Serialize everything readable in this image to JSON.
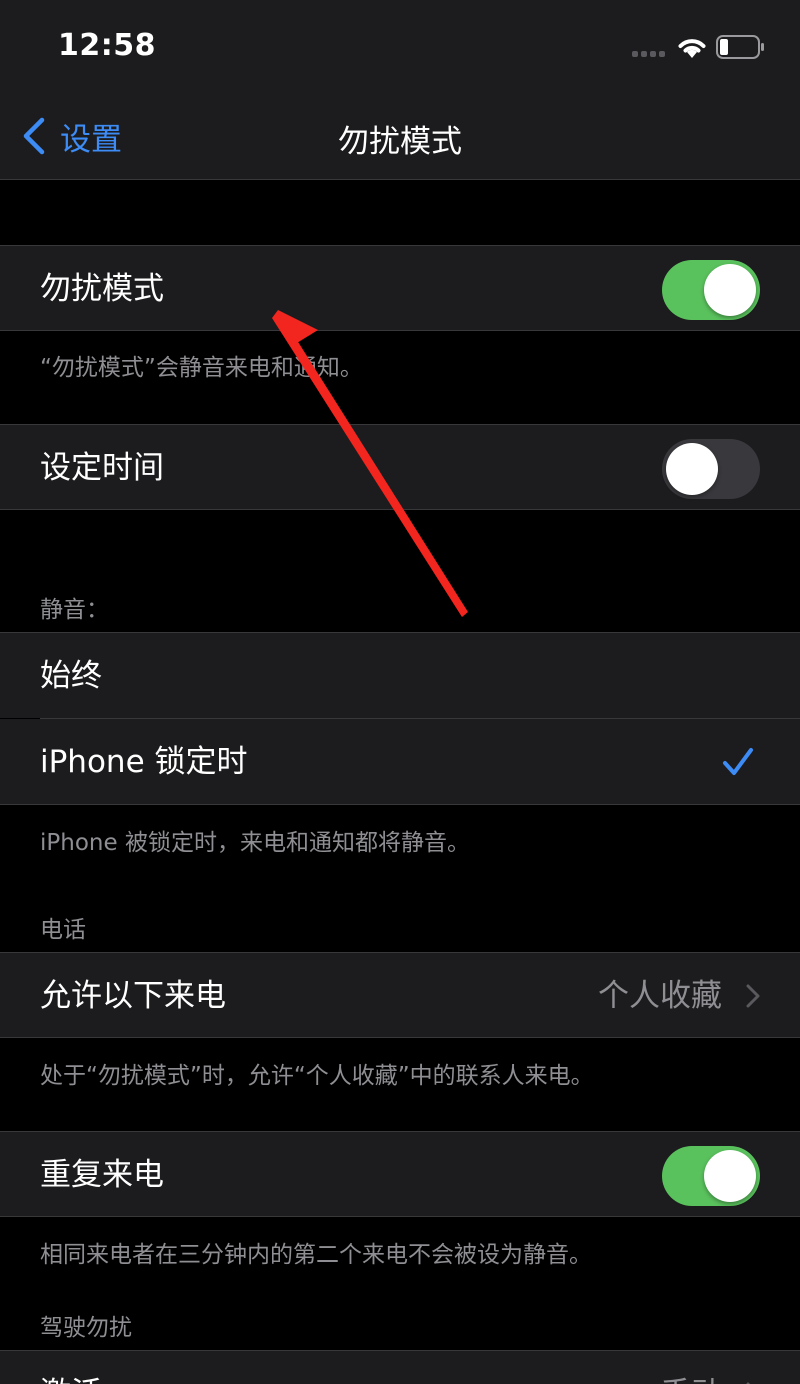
{
  "status_bar": {
    "time": "12:58"
  },
  "nav": {
    "back_label": "设置",
    "title": "勿扰模式"
  },
  "dnd": {
    "label": "勿扰模式",
    "on": true,
    "footer": "“勿扰模式”会静音来电和通知。"
  },
  "scheduled": {
    "label": "设定时间",
    "on": false
  },
  "silence": {
    "header": "静音：",
    "options": [
      {
        "label": "始终",
        "selected": false
      },
      {
        "label": "iPhone 锁定时",
        "selected": true
      }
    ],
    "footer": "iPhone 被锁定时，来电和通知都将静音。"
  },
  "phone": {
    "header": "电话",
    "allow_calls": {
      "label": "允许以下来电",
      "value": "个人收藏"
    },
    "footer": "处于“勿扰模式”时，允许“个人收藏”中的联系人来电。",
    "repeated": {
      "label": "重复来电",
      "on": true
    },
    "repeated_footer": "相同来电者在三分钟内的第二个来电不会被设为静音。"
  },
  "driving": {
    "header": "驾驶勿扰",
    "activate": {
      "label": "激活",
      "value": "手动"
    }
  },
  "colors": {
    "accent": "#3d8bf5",
    "toggle_on": "#5ac25d",
    "annotation": "#f2261f"
  }
}
